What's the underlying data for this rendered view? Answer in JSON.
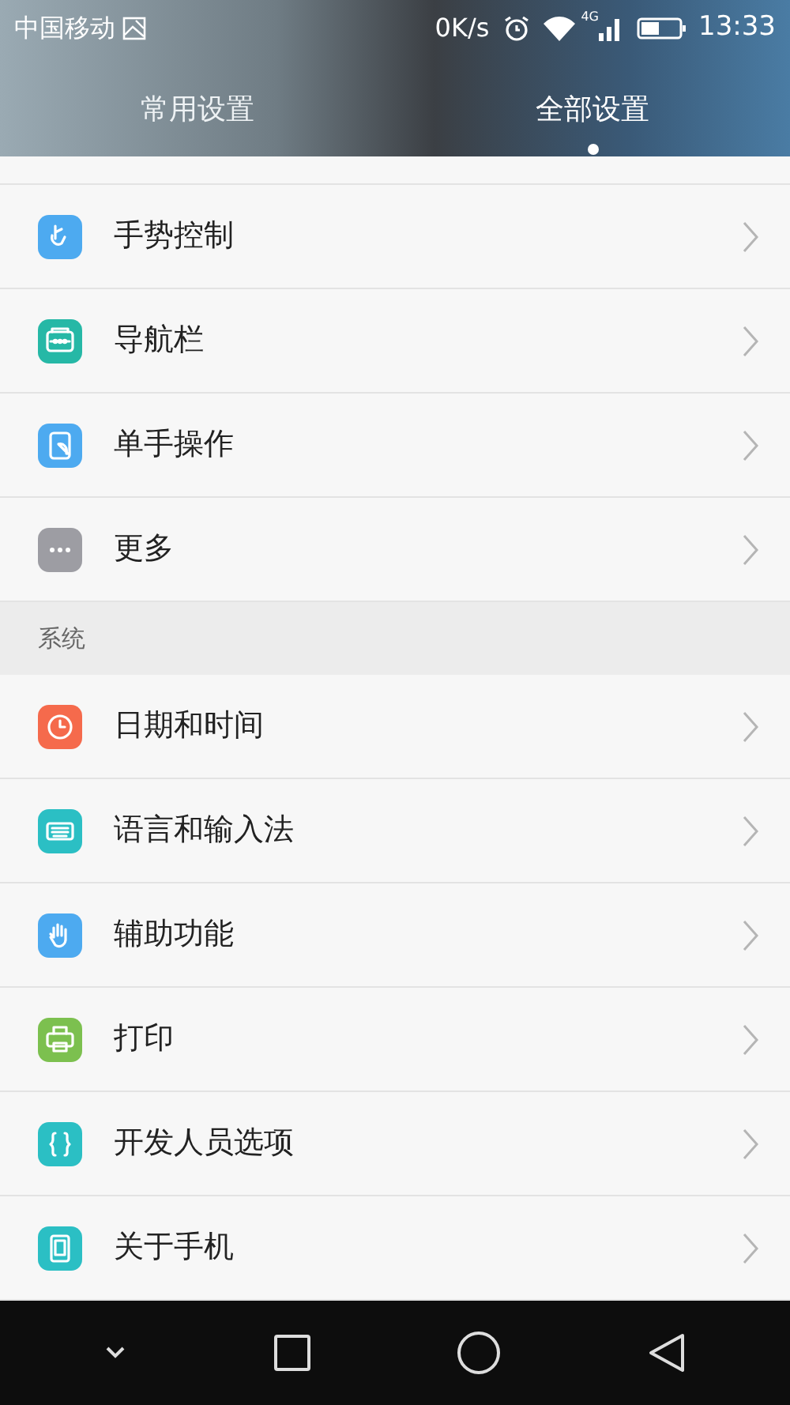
{
  "status_bar": {
    "carrier": "中国移动",
    "speed": "0K/s",
    "network": "4G",
    "time": "13:33"
  },
  "tabs": [
    {
      "label": "常用设置",
      "selected": false
    },
    {
      "label": "全部设置",
      "selected": true
    }
  ],
  "sections": [
    {
      "items": [
        {
          "label": "手势控制",
          "color": "#4daaf0"
        },
        {
          "label": "导航栏",
          "color": "#26b8a6"
        },
        {
          "label": "单手操作",
          "color": "#4daaf0"
        },
        {
          "label": "更多",
          "color": "#9d9da3"
        }
      ]
    },
    {
      "header": "系统",
      "items": [
        {
          "label": "日期和时间",
          "color": "#f56a4c"
        },
        {
          "label": "语言和输入法",
          "color": "#2bbfc4"
        },
        {
          "label": "辅助功能",
          "color": "#4daaf0"
        },
        {
          "label": "打印",
          "color": "#7cc04f"
        },
        {
          "label": "开发人员选项",
          "color": "#2bbfc4"
        },
        {
          "label": "关于手机",
          "color": "#2bbfc4"
        }
      ]
    }
  ]
}
